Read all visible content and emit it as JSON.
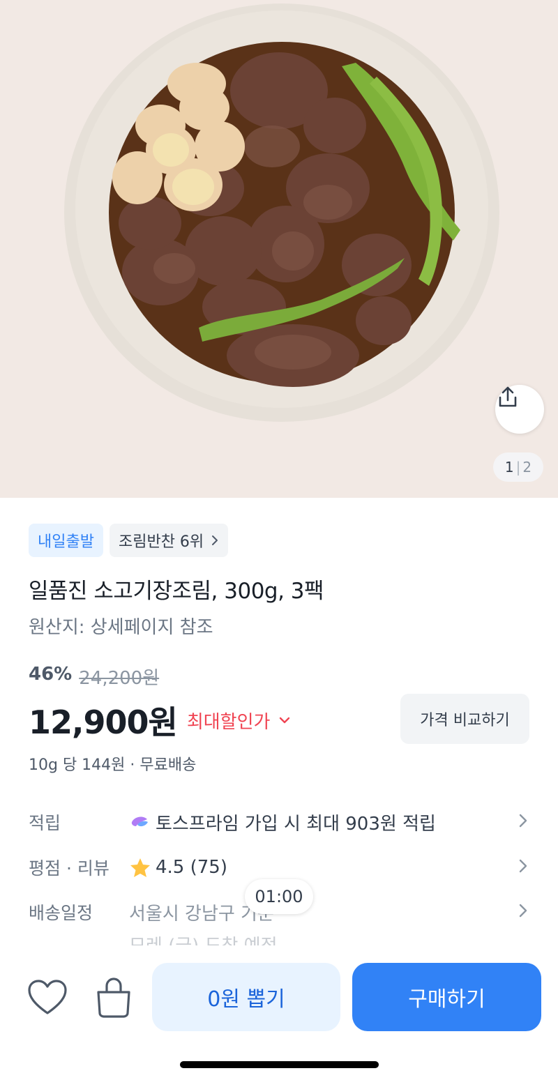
{
  "hero": {
    "image_alt": "소고기장조림 접시 사진",
    "share_icon": "share-icon",
    "pager_current": "1",
    "pager_separator": "|",
    "pager_total": "2"
  },
  "tags": [
    {
      "label": "내일출발"
    },
    {
      "label": "조림반찬 6위",
      "icon": "chevron-right-icon"
    }
  ],
  "product": {
    "title": "일품진 소고기장조림, 300g, 3팩",
    "origin": "원산지: 상세페이지 참조",
    "discount_rate": "46%",
    "original_price": "24,200원",
    "price": "12,900원",
    "max_discount_label": "최대할인가",
    "compare_label": "가격 비교하기",
    "unit_price": "10g 당 144원 · 무료배송"
  },
  "info": {
    "points_label": "적립",
    "points_value": "토스프라임 가입 시 최대 903원 적립",
    "rating_label": "평점 · 리뷰",
    "rating_value": "4.5 (75)",
    "delivery_label": "배송일정",
    "delivery_value": "서울시 강남구 기준",
    "delivery_sub": "모레 (금) 도착 예정"
  },
  "timer": "01:00",
  "bottom": {
    "heart_icon": "heart-icon",
    "cart_icon": "shopping-bag-icon",
    "draw_label": "0원 뽑기",
    "buy_label": "구매하기"
  },
  "colors": {
    "accent": "#3182f6",
    "accent_light": "#e8f3ff",
    "discount_red": "#f04452",
    "star": "#ffc342"
  }
}
